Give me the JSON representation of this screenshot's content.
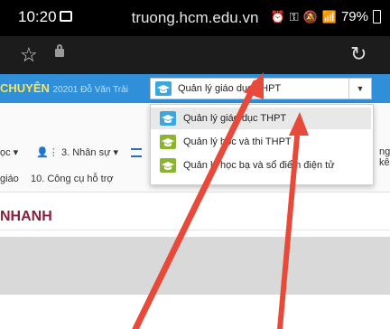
{
  "status": {
    "time": "10:20",
    "battery": "79%"
  },
  "browser": {
    "url": "truong.hcm.edu.vn"
  },
  "header": {
    "brand_text": "CHUYÊN",
    "brand_sub": "20201 Đỗ Văn Trải",
    "selected_module": "Quản lý giáo dục THPT",
    "caret": "▼"
  },
  "dropdown": {
    "options": [
      {
        "label": "Quản lý giáo dục THPT",
        "color": "#3aa7de"
      },
      {
        "label": "Quản lý học và thi THPT",
        "color": "#8bb431"
      },
      {
        "label": "Quản lý học bạ và sổ điểm điện tử",
        "color": "#8bb431"
      }
    ]
  },
  "menu": {
    "item_c": "ọc ▾",
    "item_nhan_su": "3. Nhân sự ▾",
    "item_giao": "giáo",
    "item_cong_cu": "10. Công cụ hỗ trợ",
    "item_ke": "ng kê"
  },
  "page": {
    "title": "NHANH"
  },
  "colors": {
    "header_blue": "#2f8fd9",
    "arrow_red": "#e74a3a",
    "title_color": "#8a1f3b"
  }
}
